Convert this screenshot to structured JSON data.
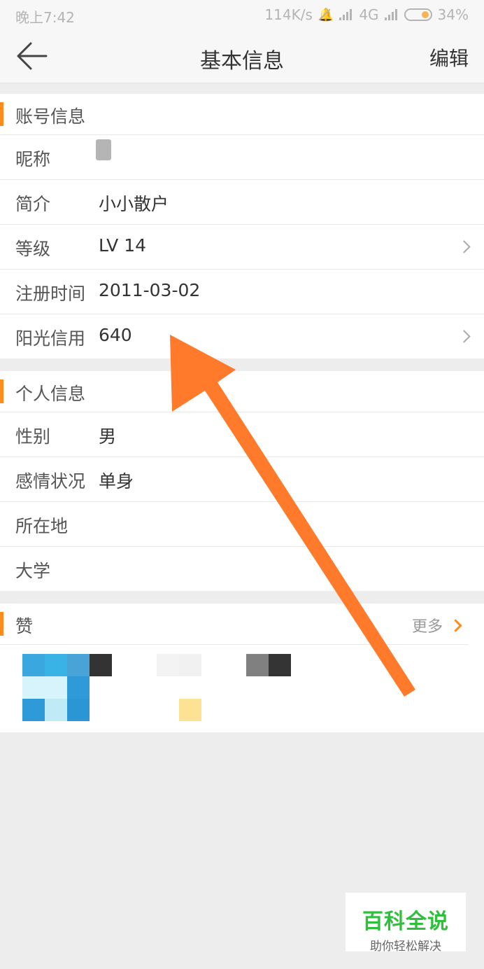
{
  "status_bar": {
    "time": "晚上7:42",
    "network_speed": "114K/s",
    "network_type": "4G",
    "battery": "34%"
  },
  "nav": {
    "back_icon": "back-arrow-icon",
    "title": "基本信息",
    "edit_label": "编辑"
  },
  "account_section": {
    "title": "账号信息",
    "rows": [
      {
        "label": "昵称",
        "value": ""
      },
      {
        "label": "简介",
        "value": "小小散户"
      },
      {
        "label": "等级",
        "value": "LV 14"
      },
      {
        "label": "注册时间",
        "value": "2011-03-02"
      },
      {
        "label": "阳光信用",
        "value": "640"
      }
    ]
  },
  "personal_section": {
    "title": "个人信息",
    "rows": [
      {
        "label": "性别",
        "value": "男"
      },
      {
        "label": "感情状况",
        "value": "单身"
      },
      {
        "label": "所在地",
        "value": ""
      },
      {
        "label": "大学",
        "value": ""
      }
    ]
  },
  "likes_section": {
    "title": "赞",
    "more_label": "更多"
  },
  "watermark": {
    "title": "百科全说",
    "subtitle": "助你轻松解决"
  },
  "colors": {
    "accent": "#ff8a1e",
    "arrow": "#ff7a2a",
    "watermark_green": "#2fbf3c"
  }
}
